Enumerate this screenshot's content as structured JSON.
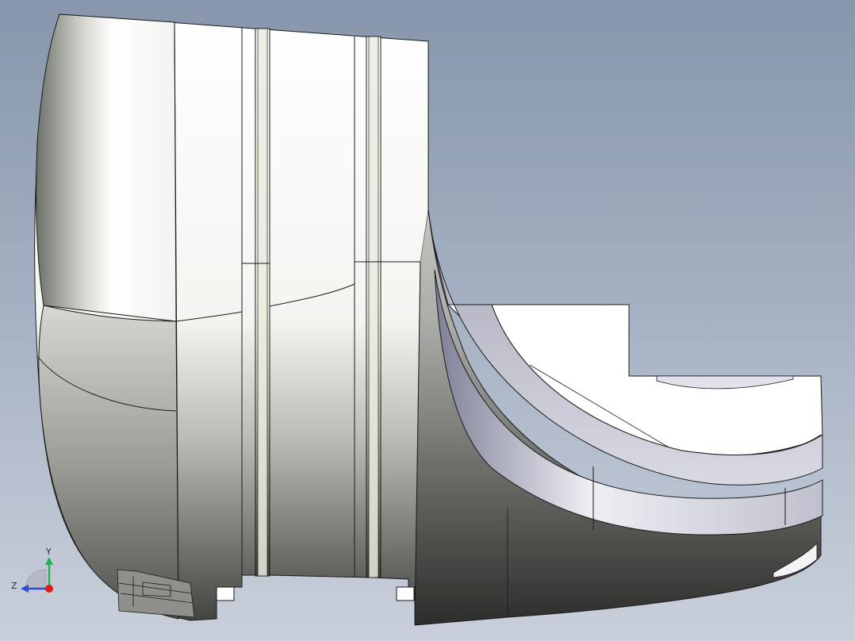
{
  "viewport": {
    "background_top": "#8796ab",
    "background_bottom": "#c9d0db"
  },
  "model": {
    "name": "",
    "edge_color": "#1a1a1a",
    "face_light": "#ffffff",
    "face_mid": "#c6c7c0",
    "face_dark": "#4a4c48",
    "groove_color": "#ecebdf"
  },
  "triad": {
    "x_axis_color": "#e0191b",
    "y_axis_color": "#22b14c",
    "z_axis_color": "#2a4fd6",
    "y_label": "Y",
    "z_label": "Z"
  }
}
